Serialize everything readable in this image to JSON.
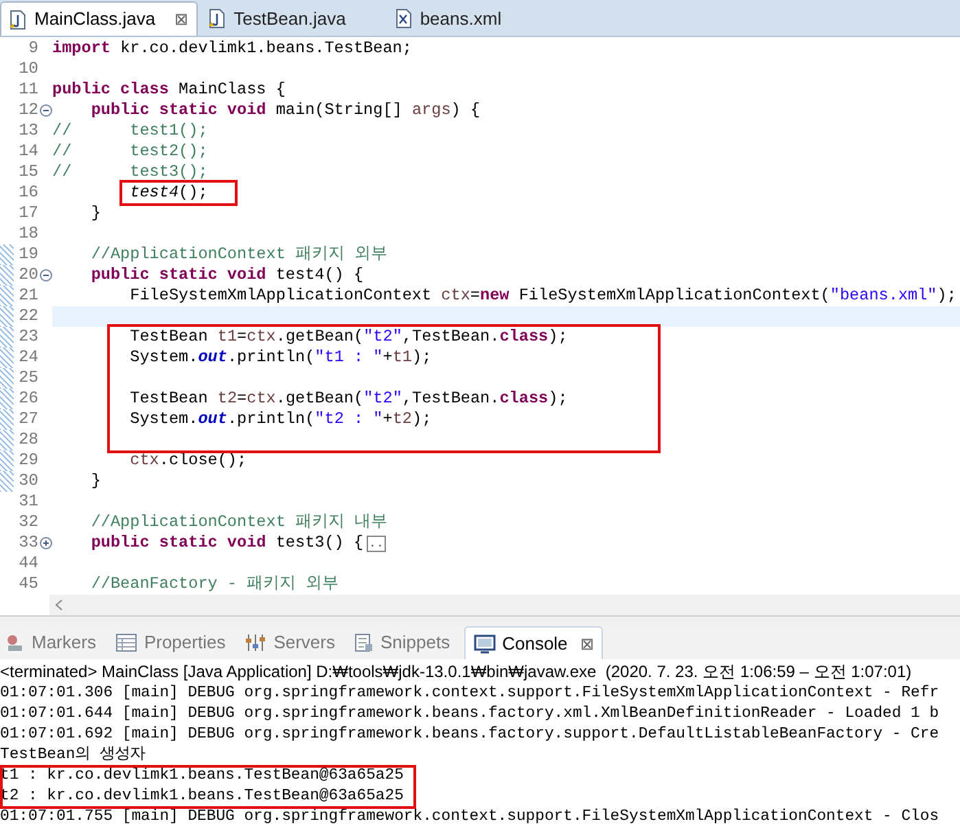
{
  "editor_tabs": [
    {
      "label": "MainClass.java",
      "kind": "java",
      "selected": true,
      "close": "⊠"
    },
    {
      "label": "TestBean.java",
      "kind": "java",
      "selected": false
    },
    {
      "label": "beans.xml",
      "kind": "xml",
      "selected": false
    }
  ],
  "code_lines": [
    {
      "number": "9",
      "current": false,
      "changed": false,
      "boxed": false,
      "tokens": [
        {
          "kind": "kw",
          "text": "import"
        },
        {
          "kind": "plain",
          "text": " kr.co.devlimk1.beans.TestBean;"
        }
      ]
    },
    {
      "number": "10",
      "current": false,
      "changed": false,
      "boxed": false
    },
    {
      "number": "11",
      "current": false,
      "changed": false,
      "boxed": false,
      "tokens": [
        {
          "kind": "kw",
          "text": "public class"
        },
        {
          "kind": "plain",
          "text": " MainClass {"
        }
      ]
    },
    {
      "number": "12",
      "expanded": true,
      "current": false,
      "changed": false,
      "boxed": false,
      "tokens": [
        {
          "kind": "kw",
          "text": "    public static void"
        },
        {
          "kind": "plain",
          "text": " main(String[] "
        },
        {
          "kind": "var",
          "text": "args"
        },
        {
          "kind": "plain",
          "text": ") {"
        }
      ]
    },
    {
      "number": "13",
      "current": false,
      "changed": false,
      "boxed": false,
      "tokens": [
        {
          "kind": "comment",
          "text": "//      test1();"
        }
      ]
    },
    {
      "number": "14",
      "current": false,
      "changed": false,
      "boxed": false,
      "tokens": [
        {
          "kind": "comment",
          "text": "//      test2();"
        }
      ]
    },
    {
      "number": "15",
      "current": false,
      "changed": false,
      "boxed": false,
      "tokens": [
        {
          "kind": "comment",
          "text": "//      test3();"
        }
      ]
    },
    {
      "number": "16",
      "current": false,
      "changed": false,
      "boxed": true,
      "tokens": [
        {
          "kind": "call",
          "text": "        test4"
        },
        {
          "kind": "plain",
          "text": "();"
        }
      ]
    },
    {
      "number": "17",
      "current": false,
      "changed": false,
      "boxed": false,
      "tokens": [
        {
          "kind": "plain",
          "text": "    }"
        }
      ]
    },
    {
      "number": "18",
      "current": false,
      "changed": false,
      "boxed": false
    },
    {
      "number": "19",
      "current": false,
      "changed": true,
      "boxed": false,
      "tokens": [
        {
          "kind": "comment",
          "text": "    //ApplicationContext 패키지 외부"
        }
      ]
    },
    {
      "number": "20",
      "expanded": true,
      "current": false,
      "changed": true,
      "boxed": false,
      "tokens": [
        {
          "kind": "kw",
          "text": "    public static void"
        },
        {
          "kind": "plain",
          "text": " test4() {"
        }
      ]
    },
    {
      "number": "21",
      "current": false,
      "changed": true,
      "boxed": false,
      "tokens": [
        {
          "kind": "plain",
          "text": "        FileSystemXmlApplicationContext "
        },
        {
          "kind": "var",
          "text": "ctx"
        },
        {
          "kind": "plain",
          "text": "="
        },
        {
          "kind": "kw",
          "text": "new"
        },
        {
          "kind": "plain",
          "text": " FileSystemXmlApplicationContext("
        },
        {
          "kind": "str",
          "text": "\"beans.xml\""
        },
        {
          "kind": "plain",
          "text": ");"
        }
      ]
    },
    {
      "number": "22",
      "current": true,
      "changed": true,
      "boxed": false
    },
    {
      "number": "23",
      "current": false,
      "changed": true,
      "boxed": true,
      "tokens": [
        {
          "kind": "plain",
          "text": "        TestBean "
        },
        {
          "kind": "var",
          "text": "t1"
        },
        {
          "kind": "plain",
          "text": "="
        },
        {
          "kind": "var",
          "text": "ctx"
        },
        {
          "kind": "plain",
          "text": ".getBean("
        },
        {
          "kind": "str",
          "text": "\"t2\""
        },
        {
          "kind": "plain",
          "text": ",TestBean."
        },
        {
          "kind": "kw",
          "text": "class"
        },
        {
          "kind": "plain",
          "text": ");"
        }
      ]
    },
    {
      "number": "24",
      "current": false,
      "changed": true,
      "boxed": true,
      "tokens": [
        {
          "kind": "plain",
          "text": "        System."
        },
        {
          "kind": "field",
          "text": "out"
        },
        {
          "kind": "plain",
          "text": ".println("
        },
        {
          "kind": "str",
          "text": "\"t1 : \""
        },
        {
          "kind": "plain",
          "text": "+"
        },
        {
          "kind": "var",
          "text": "t1"
        },
        {
          "kind": "plain",
          "text": ");"
        }
      ]
    },
    {
      "number": "25",
      "current": false,
      "changed": true,
      "boxed": true
    },
    {
      "number": "26",
      "current": false,
      "changed": true,
      "boxed": true,
      "tokens": [
        {
          "kind": "plain",
          "text": "        TestBean "
        },
        {
          "kind": "var",
          "text": "t2"
        },
        {
          "kind": "plain",
          "text": "="
        },
        {
          "kind": "var",
          "text": "ctx"
        },
        {
          "kind": "plain",
          "text": ".getBean("
        },
        {
          "kind": "str",
          "text": "\"t2\""
        },
        {
          "kind": "plain",
          "text": ",TestBean."
        },
        {
          "kind": "kw",
          "text": "class"
        },
        {
          "kind": "plain",
          "text": ");"
        }
      ]
    },
    {
      "number": "27",
      "current": false,
      "changed": true,
      "boxed": true,
      "tokens": [
        {
          "kind": "plain",
          "text": "        System."
        },
        {
          "kind": "field",
          "text": "out"
        },
        {
          "kind": "plain",
          "text": ".println("
        },
        {
          "kind": "str",
          "text": "\"t2 : \""
        },
        {
          "kind": "plain",
          "text": "+"
        },
        {
          "kind": "var",
          "text": "t2"
        },
        {
          "kind": "plain",
          "text": ");"
        }
      ]
    },
    {
      "number": "28",
      "current": false,
      "changed": true,
      "boxed": true
    },
    {
      "number": "29",
      "current": false,
      "changed": true,
      "boxed": false,
      "tokens": [
        {
          "kind": "var",
          "text": "        ctx"
        },
        {
          "kind": "plain",
          "text": ".close();"
        }
      ]
    },
    {
      "number": "30",
      "current": false,
      "changed": true,
      "boxed": false,
      "tokens": [
        {
          "kind": "plain",
          "text": "    }"
        }
      ]
    },
    {
      "number": "31",
      "current": false,
      "changed": false,
      "boxed": false
    },
    {
      "number": "32",
      "current": false,
      "changed": false,
      "boxed": false,
      "tokens": [
        {
          "kind": "comment",
          "text": "    //ApplicationContext 패키지 내부"
        }
      ]
    },
    {
      "number": "33",
      "expanded": false,
      "current": false,
      "changed": false,
      "boxed": false,
      "tokens": [
        {
          "kind": "kw",
          "text": "    public static void"
        },
        {
          "kind": "plain",
          "text": " test3() {"
        },
        {
          "kind": "folded",
          "text": ".."
        }
      ]
    },
    {
      "number": "44",
      "current": false,
      "changed": false,
      "boxed": false
    },
    {
      "number": "45",
      "current": false,
      "changed": false,
      "boxed": false,
      "tokens": [
        {
          "kind": "comment",
          "text": "    //BeanFactory - 패키지 외부"
        }
      ]
    }
  ],
  "panel_tabs": [
    {
      "label": "Markers",
      "kind": "markers",
      "selected": false
    },
    {
      "label": "Properties",
      "kind": "properties",
      "selected": false
    },
    {
      "label": "Servers",
      "kind": "servers",
      "selected": false
    },
    {
      "label": "Snippets",
      "kind": "snippets",
      "selected": false
    },
    {
      "label": "Console",
      "kind": "console",
      "selected": true,
      "close": "⊠"
    }
  ],
  "console": {
    "header": "<terminated> MainClass [Java Application] D:₩tools₩jdk-13.0.1₩bin₩javaw.exe  (2020. 7. 23. 오전 1:06:59 – 오전 1:07:01)",
    "lines": [
      {
        "text": "01:07:01.306 [main] DEBUG org.springframework.context.support.FileSystemXmlApplicationContext - Refr",
        "boxed": false
      },
      {
        "text": "01:07:01.644 [main] DEBUG org.springframework.beans.factory.xml.XmlBeanDefinitionReader - Loaded 1 b",
        "boxed": false
      },
      {
        "text": "01:07:01.692 [main] DEBUG org.springframework.beans.factory.support.DefaultListableBeanFactory - Cre",
        "boxed": false
      },
      {
        "text": "TestBean의 생성자",
        "boxed": false
      },
      {
        "text": "t1 : kr.co.devlimk1.beans.TestBean@63a65a25",
        "boxed": true
      },
      {
        "text": "t2 : kr.co.devlimk1.beans.TestBean@63a65a25",
        "boxed": true
      },
      {
        "text": "01:07:01.755 [main] DEBUG org.springframework.context.support.FileSystemXmlApplicationContext - Clos",
        "boxed": false
      }
    ]
  }
}
